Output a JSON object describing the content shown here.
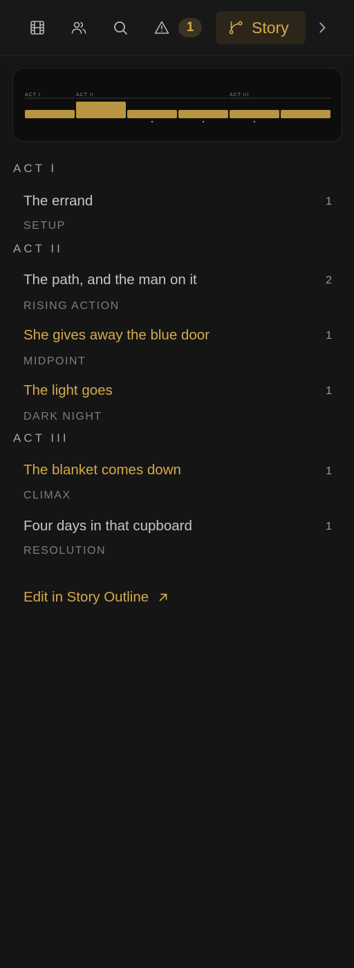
{
  "toolbar": {
    "icons": [
      "film-icon",
      "people-icon",
      "search-icon",
      "warning-icon"
    ],
    "warning_count": "1",
    "story_label": "Story",
    "story_icon": "branch-icon",
    "more_icon": "chevron-right-icon"
  },
  "timeline": {
    "act_labels": [
      "ACT I",
      "ACT II",
      "ACT III"
    ]
  },
  "outline": {
    "acts": [
      {
        "label": "ACT I",
        "beats": [
          {
            "title": "The errand",
            "count": "1",
            "kind": "SETUP",
            "highlight": false
          }
        ]
      },
      {
        "label": "ACT II",
        "beats": [
          {
            "title": "The path, and the man on it",
            "count": "2",
            "kind": "RISING ACTION",
            "highlight": false
          },
          {
            "title": "She gives away the blue door",
            "count": "1",
            "kind": "MIDPOINT",
            "highlight": true
          },
          {
            "title": "The light goes",
            "count": "1",
            "kind": "DARK NIGHT",
            "highlight": true
          }
        ]
      },
      {
        "label": "ACT III",
        "beats": [
          {
            "title": "The blanket comes down",
            "count": "1",
            "kind": "CLIMAX",
            "highlight": true
          },
          {
            "title": "Four days in that cupboard",
            "count": "1",
            "kind": "RESOLUTION",
            "highlight": false
          }
        ]
      }
    ],
    "edit_link_label": "Edit in Story Outline"
  },
  "colors": {
    "accent": "#d4aa4e",
    "background": "#151515",
    "text": "#c6c6c6",
    "muted": "#7d7d7d"
  }
}
